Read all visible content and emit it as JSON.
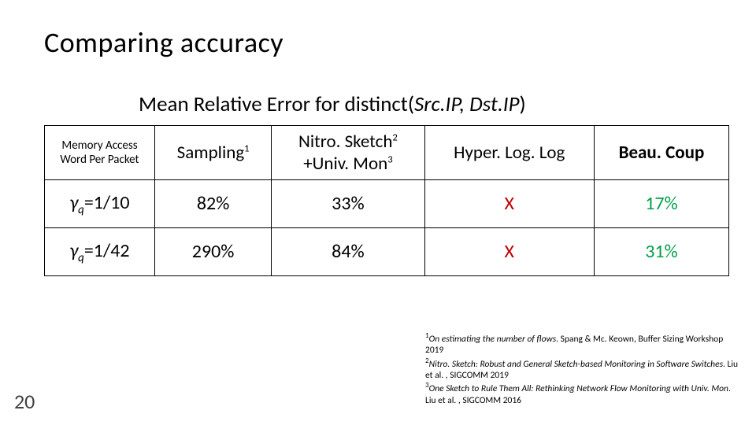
{
  "title": "Comparing accuracy",
  "subtitle_prefix": "Mean Relative Error  for  distinct(",
  "subtitle_param": "Src.IP, Dst.IP",
  "subtitle_suffix": ")",
  "page_number": "20",
  "chart_data": {
    "type": "table",
    "title": "Mean Relative Error for distinct(Src.IP, Dst.IP)",
    "columns": [
      {
        "label": "Memory Access Word Per Packet",
        "sup": ""
      },
      {
        "label": "Sampling",
        "sup": "1"
      },
      {
        "label": "Nitro. Sketch +Univ. Mon",
        "sup": "2,3"
      },
      {
        "label": "Hyper. Log. Log",
        "sup": ""
      },
      {
        "label": "Beau. Coup",
        "sup": ""
      }
    ],
    "rows": [
      {
        "label": "γq=1/10",
        "values": [
          "82%",
          "33%",
          "X",
          "17%"
        ]
      },
      {
        "label": "γq=1/42",
        "values": [
          "290%",
          "84%",
          "X",
          "31%"
        ]
      }
    ]
  },
  "table": {
    "header": {
      "rowhdr_line1": "Memory Access",
      "rowhdr_line2": "Word Per Packet",
      "c1": "Sampling",
      "c1_sup": "1",
      "c2_line1": "Nitro. Sketch",
      "c2_sup1": "2",
      "c2_line2": "+Univ. Mon",
      "c2_sup2": "3",
      "c3": "Hyper. Log. Log",
      "c4": "Beau. Coup"
    },
    "r1": {
      "gamma": "γ",
      "q": "q",
      "eq": "=1/10",
      "c1": "82%",
      "c2": "33%",
      "c3": "X",
      "c4": "17%"
    },
    "r2": {
      "gamma": "γ",
      "q": "q",
      "eq": "=1/42",
      "c1": "290%",
      "c2": "84%",
      "c3": "X",
      "c4": "31%"
    }
  },
  "footnotes": {
    "f1_sup": "1",
    "f1_title": "On estimating the number of flows",
    "f1_rest": ".  Spang  &  Mc. Keown, Buffer  Sizing  Workshop  2019",
    "f2_sup": "2",
    "f2_title": "Nitro. Sketch: Robust and General Sketch-based Monitoring in Software Switches",
    "f2_rest": ".  Liu  et  al. ,  SIGCOMM  2019",
    "f3_sup": "3",
    "f3_title": "One Sketch to Rule Them All: Rethinking Network Flow Monitoring with Univ. Mon",
    "f3_rest": ".  Liu  et  al. ,  SIGCOMM  2016"
  }
}
